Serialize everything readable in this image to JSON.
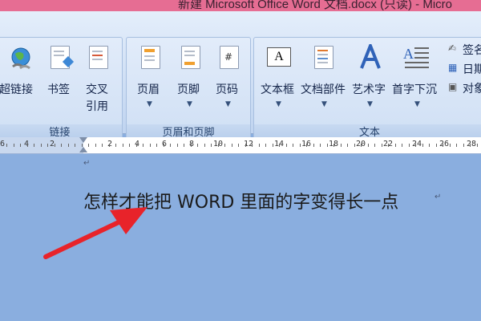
{
  "window": {
    "title": "新建 Microsoft Office Word 文档.docx (只读) - Micro"
  },
  "ribbon": {
    "groups": [
      {
        "label": "链接",
        "buttons": [
          {
            "label": "超链接"
          },
          {
            "label": "书签"
          },
          {
            "label": "交叉引用",
            "line1": "交叉",
            "line2": "引用"
          }
        ]
      },
      {
        "label": "页眉和页脚",
        "buttons": [
          {
            "label": "页眉"
          },
          {
            "label": "页脚"
          },
          {
            "label": "页码"
          }
        ]
      },
      {
        "label": "文本",
        "buttons": [
          {
            "label": "文本框"
          },
          {
            "label": "文档部件"
          },
          {
            "label": "艺术字"
          },
          {
            "label": "首字下沉"
          }
        ],
        "small_buttons": [
          {
            "label": "签名"
          },
          {
            "label": "日期"
          },
          {
            "label": "对象"
          }
        ]
      }
    ]
  },
  "ruler": {
    "numbers": [
      "6",
      "4",
      "2",
      "2",
      "4",
      "6",
      "8",
      "10",
      "12",
      "14",
      "16",
      "18",
      "20",
      "22",
      "24",
      "26",
      "28"
    ]
  },
  "document": {
    "line_text": "怎样才能把 WORD 里面的字变得长一点",
    "paragraph_mark": "↵"
  },
  "annotation": {
    "arrow_color": "#e8232a"
  },
  "colors": {
    "title_bar": "#e66d93",
    "ribbon": "#dbe7f7",
    "document_bg": "#8aaedf"
  }
}
